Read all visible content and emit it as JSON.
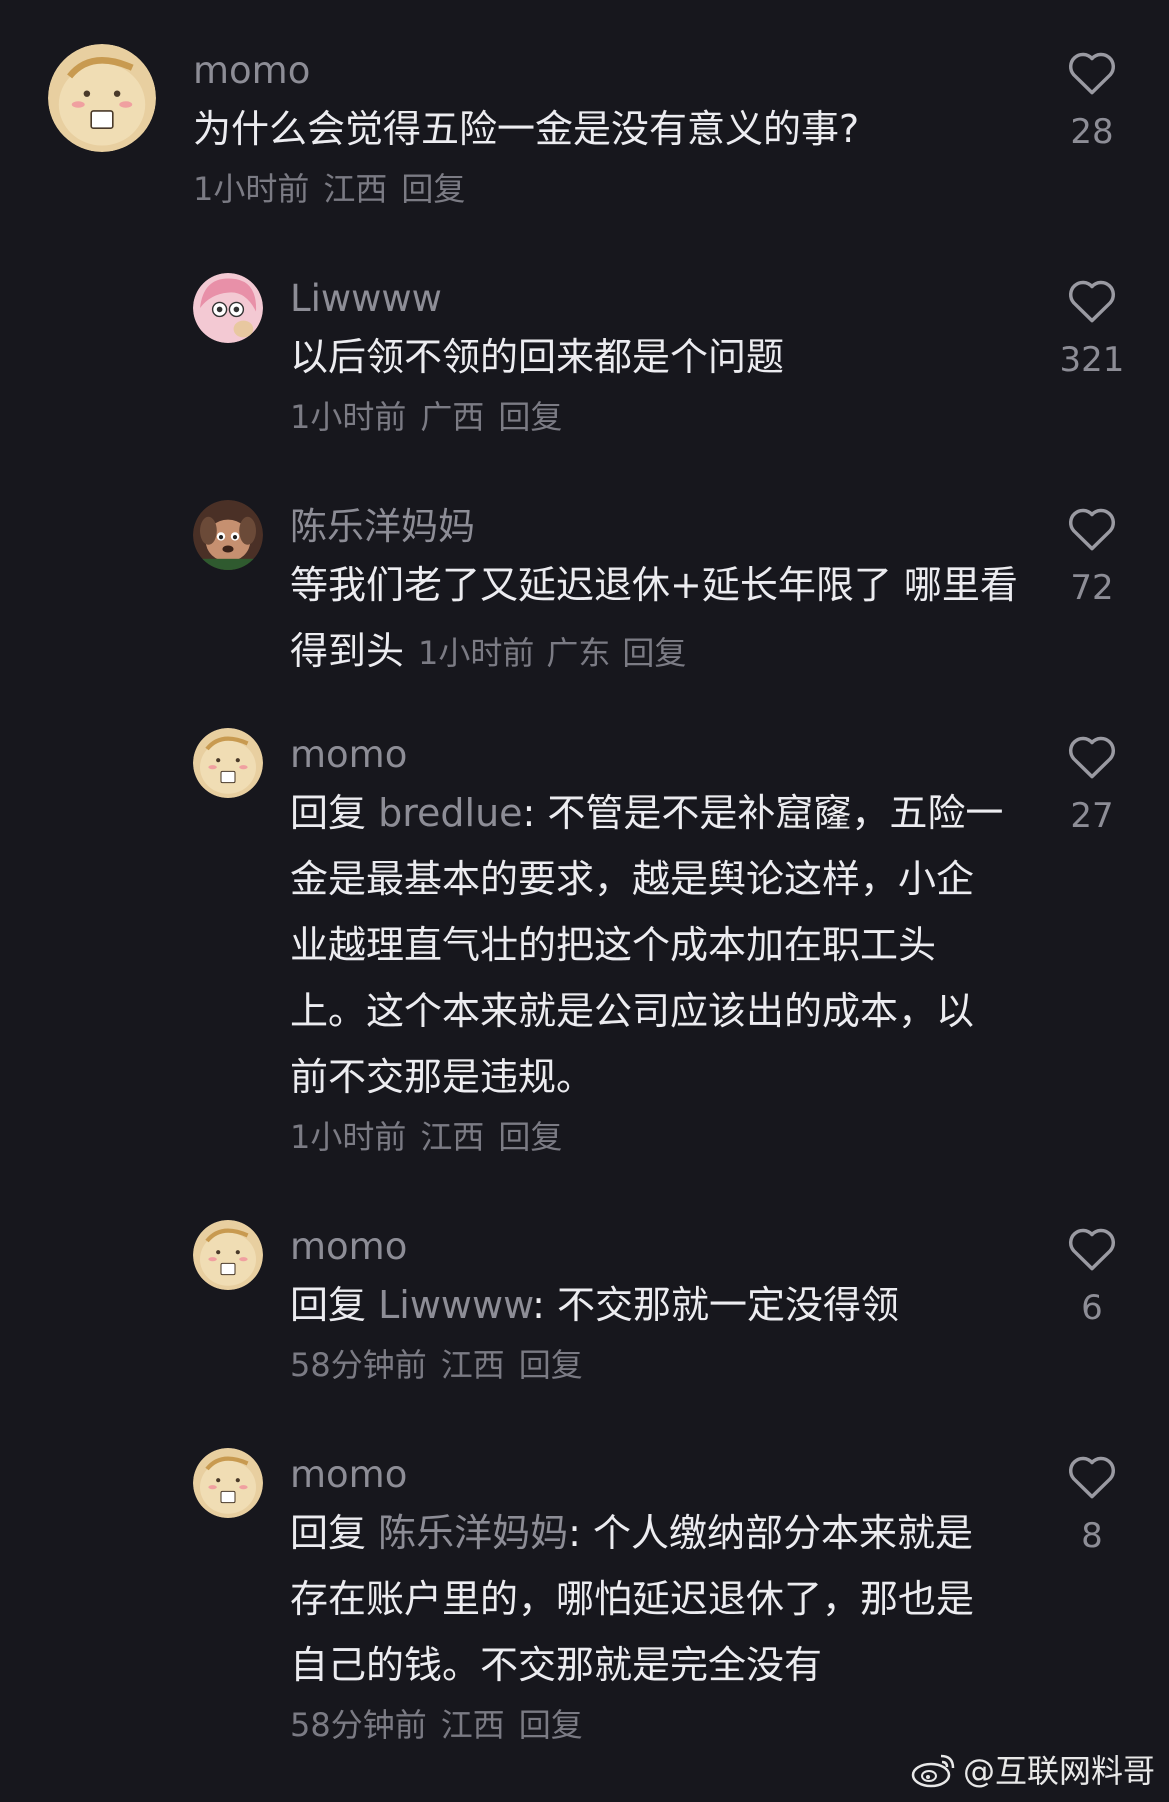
{
  "comments": [
    {
      "username": "momo",
      "text": "为什么会觉得五险一金是没有意义的事?",
      "time": "1小时前",
      "location": "江西",
      "reply_label": "回复",
      "likes": "28",
      "avatar_icon": "potato-coffee-avatar"
    },
    {
      "username": "Liwwww",
      "text": "以后领不领的回来都是个问题",
      "time": "1小时前",
      "location": "广西",
      "reply_label": "回复",
      "likes": "321",
      "avatar_icon": "pink-hair-girl-avatar"
    },
    {
      "username": "陈乐洋妈妈",
      "text": "等我们老了又延迟退休+延长年限了 哪里看得到头",
      "time": "1小时前",
      "location": "广东",
      "reply_label": "回复",
      "likes": "72",
      "avatar_icon": "cartoon-dog-avatar"
    },
    {
      "username": "momo",
      "reply_prefix": "回复",
      "reply_to": "bredlue",
      "text": ": 不管是不是补窟窿，五险一金是最基本的要求，越是舆论这样，小企业越理直气壮的把这个成本加在职工头上。这个本来就是公司应该出的成本，以前不交那是违规。",
      "time": "1小时前",
      "location": "江西",
      "reply_label": "回复",
      "likes": "27",
      "avatar_icon": "potato-coffee-avatar"
    },
    {
      "username": "momo",
      "reply_prefix": "回复",
      "reply_to": "Liwwww",
      "text": ": 不交那就一定没得领",
      "time": "58分钟前",
      "location": "江西",
      "reply_label": "回复",
      "likes": "6",
      "avatar_icon": "potato-coffee-avatar"
    },
    {
      "username": "momo",
      "reply_prefix": "回复",
      "reply_to": "陈乐洋妈妈",
      "text": ": 个人缴纳部分本来就是存在账户里的，哪怕延迟退休了，那也是自己的钱。不交那就是完全没有",
      "time": "58分钟前",
      "location": "江西",
      "reply_label": "回复",
      "likes": "8",
      "avatar_icon": "potato-coffee-avatar"
    }
  ],
  "watermark": {
    "text": "@互联网料哥",
    "icon": "weibo-logo-icon"
  },
  "colors": {
    "background": "#17171d",
    "username": "#8d8d96",
    "text": "#ececf0",
    "meta": "#7b7b84"
  }
}
